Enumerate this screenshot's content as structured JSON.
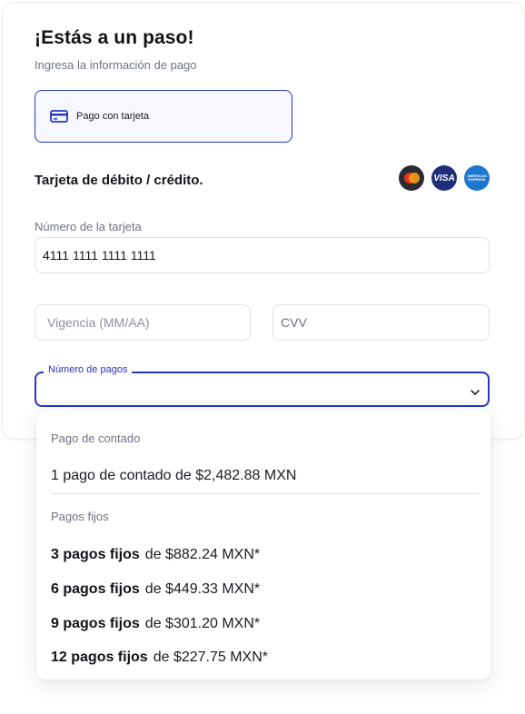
{
  "header": {
    "title": "¡Estás a un paso!",
    "subtitle": "Ingresa la información de pago"
  },
  "payment_method": {
    "icon": "credit-card-icon",
    "label": "Pago con tarjeta"
  },
  "section": {
    "title": "Tarjeta de débito / crédito."
  },
  "brands": {
    "visa_label": "VISA",
    "amex_label": "AMERICAN EXPRESS"
  },
  "form": {
    "card_number_label": "Número de la tarjeta",
    "card_number_value": "4111 1111 1111 1111",
    "expiry_placeholder": "Vigencia (MM/AA)",
    "cvv_placeholder": "CVV",
    "installments_label": "Número de pagos"
  },
  "dropdown": {
    "group_cash": "Pago de contado",
    "cash_option": "1 pago de contado de $2,482.88 MXN",
    "group_fixed": "Pagos fijos",
    "fixed_options": [
      {
        "count": "3 pagos fijos",
        "amount": "de $882.24 MXN*"
      },
      {
        "count": "6 pagos fijos",
        "amount": "de $449.33 MXN*"
      },
      {
        "count": "9 pagos fijos",
        "amount": "de $301.20 MXN*"
      },
      {
        "count": "12 pagos fijos",
        "amount": "de $227.75 MXN*"
      }
    ]
  },
  "colors": {
    "accent": "#2336c2",
    "mastercard_red": "#e8321b",
    "mastercard_orange": "#f59f1a",
    "visa_blue": "#1f2e7a",
    "amex_blue": "#1c77d1"
  }
}
